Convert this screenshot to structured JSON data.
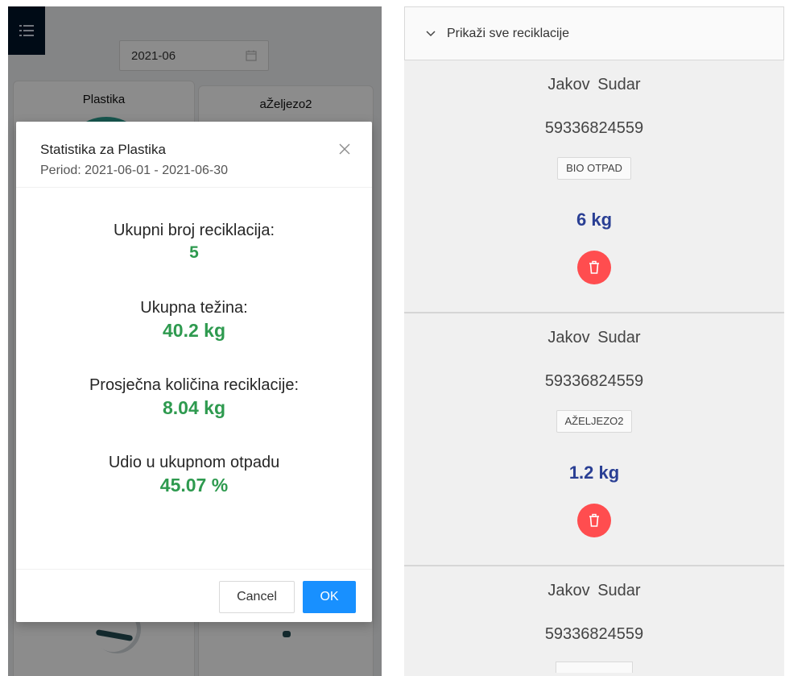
{
  "left": {
    "date_value": "2021-06",
    "categories": [
      "Plastika",
      "aŽeljezo2"
    ]
  },
  "modal": {
    "title": "Statistika za Plastika",
    "subtitle": "Period: 2021-06-01 - 2021-06-30",
    "stats": [
      {
        "label": "Ukupni broj reciklacija:",
        "value": "5"
      },
      {
        "label": "Ukupna težina:",
        "value": "40.2 kg"
      },
      {
        "label": "Prosječna količina reciklacije:",
        "value": "8.04 kg"
      },
      {
        "label": "Udio u ukupnom otpadu",
        "value": "45.07 %"
      }
    ],
    "cancel_label": "Cancel",
    "ok_label": "OK"
  },
  "right": {
    "collapse_label": "Prikaži sve reciklacije",
    "records": [
      {
        "name": "Jakov Sudar",
        "id": "59336824559",
        "tag": "BIO OTPAD",
        "weight": "6 kg"
      },
      {
        "name": "Jakov Sudar",
        "id": "59336824559",
        "tag": "AŽELJEZO2",
        "weight": "1.2 kg"
      },
      {
        "name": "Jakov Sudar",
        "id": "59336824559"
      }
    ]
  },
  "colors": {
    "stat_value": "#2e9a4f",
    "weight": "#2a3f94",
    "primary": "#1890ff",
    "danger": "#ff4d4f",
    "menu_bg": "#001529"
  },
  "icons": [
    "menu-icon",
    "calendar-icon",
    "close-icon",
    "chevron-down-icon",
    "trash-icon"
  ]
}
